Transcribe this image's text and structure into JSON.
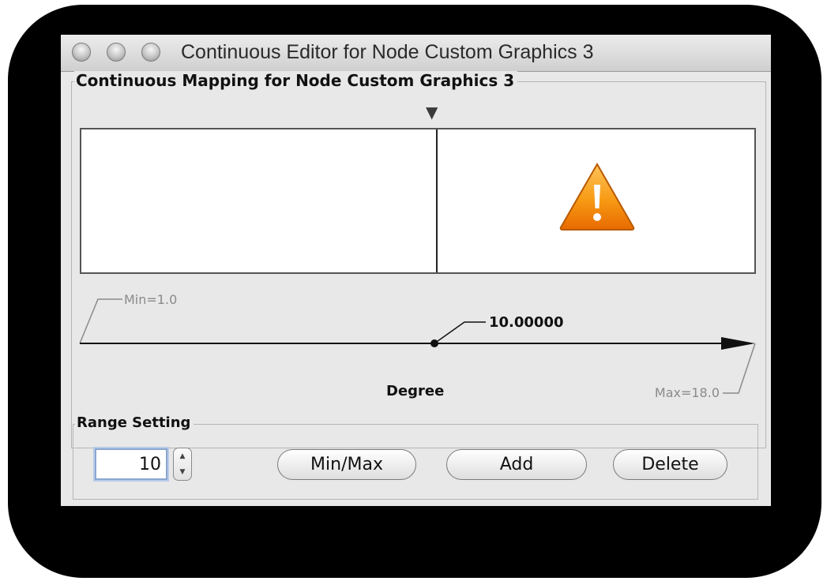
{
  "window": {
    "title": "Continuous Editor for Node Custom Graphics 3"
  },
  "mapping": {
    "group_title": "Continuous Mapping for Node Custom Graphics 3",
    "min_label": "Min=1.0",
    "max_label": "Max=18.0",
    "point_value": "10.00000",
    "axis_label": "Degree",
    "warning_icon": "warning-triangle-icon",
    "warning_color": "#f39200"
  },
  "range": {
    "group_title": "Range Setting",
    "value": "10",
    "buttons": {
      "minmax": "Min/Max",
      "add": "Add",
      "delete": "Delete"
    }
  }
}
